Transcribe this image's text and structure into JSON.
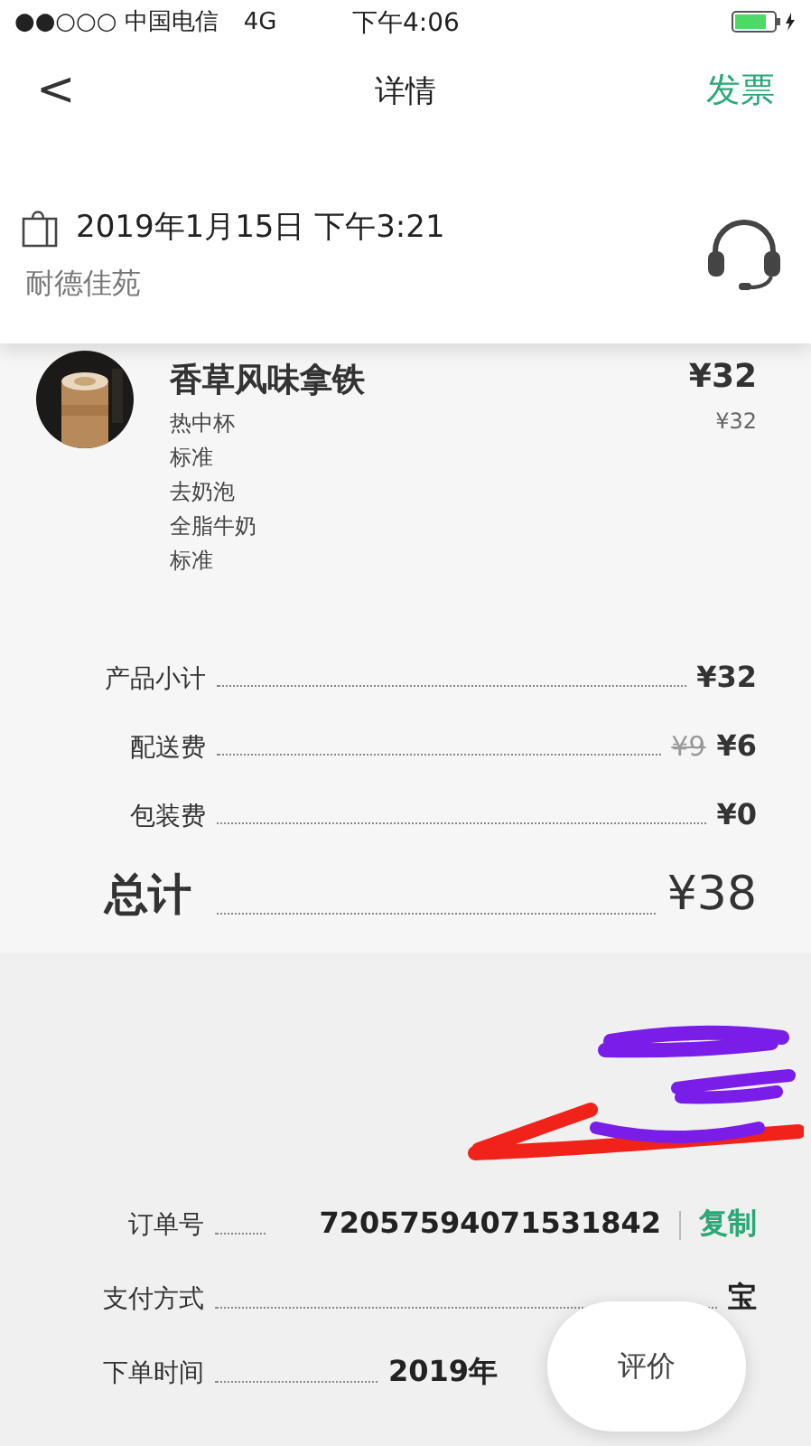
{
  "status_bar": {
    "carrier": "●●○○○ 中国电信",
    "network": "4G",
    "time": "下午4:06"
  },
  "nav": {
    "back": "<",
    "title": "详情",
    "action": "发票"
  },
  "order_header": {
    "datetime": "2019年1月15日 下午3:21",
    "store": "耐德佳苑"
  },
  "items": [
    {
      "name": "香草风味拿铁",
      "price": "¥32",
      "options": [
        "热中杯",
        "标准",
        "去奶泡",
        "全脂牛奶",
        "标准"
      ],
      "unit_price": "¥32"
    }
  ],
  "summary": [
    {
      "kind": "plain",
      "label": "产品小计",
      "value": "¥32"
    },
    {
      "kind": "discounted",
      "label": "配送费",
      "original": "¥9",
      "value": "¥6"
    },
    {
      "kind": "plain",
      "label": "包装费",
      "value": "¥0"
    },
    {
      "kind": "total",
      "label": "总计",
      "value": "¥38"
    }
  ],
  "order_info": [
    {
      "kind": "copyable",
      "label": "订单号",
      "value": "72057594071531842",
      "action": "复制"
    },
    {
      "kind": "plain",
      "label": "支付方式",
      "value": "宝"
    },
    {
      "kind": "partial",
      "label": "下单时间",
      "value": "2019年"
    }
  ],
  "floating_button": {
    "label": "评价"
  }
}
